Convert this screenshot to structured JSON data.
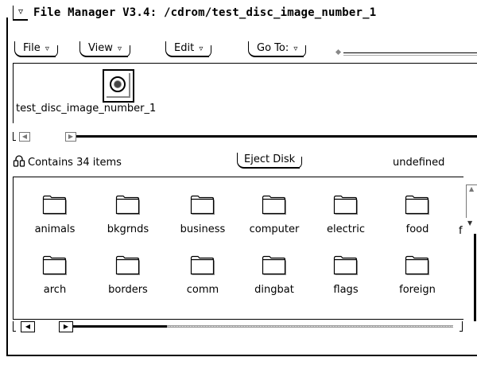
{
  "window": {
    "title": "File Manager V3.4: /cdrom/test_disc_image_number_1"
  },
  "menubar": {
    "items": [
      {
        "label": "File"
      },
      {
        "label": "View"
      },
      {
        "label": "Edit"
      },
      {
        "label": "Go To:"
      }
    ],
    "goto_value": ""
  },
  "path_panel": {
    "label": "test_disc_image_number_1",
    "icon": "cdrom-disc-icon"
  },
  "status": {
    "text": "Contains 34 items",
    "eject_label": "Eject Disk",
    "right_text": "undefined"
  },
  "folders": [
    {
      "name": "animals"
    },
    {
      "name": "bkgrnds"
    },
    {
      "name": "business"
    },
    {
      "name": "computer"
    },
    {
      "name": "electric"
    },
    {
      "name": "food"
    },
    {
      "name": "arch"
    },
    {
      "name": "borders"
    },
    {
      "name": "comm"
    },
    {
      "name": "dingbat"
    },
    {
      "name": "flags"
    },
    {
      "name": "foreign"
    }
  ],
  "clipped_item_letter": "f",
  "colors": {
    "background": "#ffffff",
    "foreground": "#000000",
    "inactive": "#777777"
  }
}
